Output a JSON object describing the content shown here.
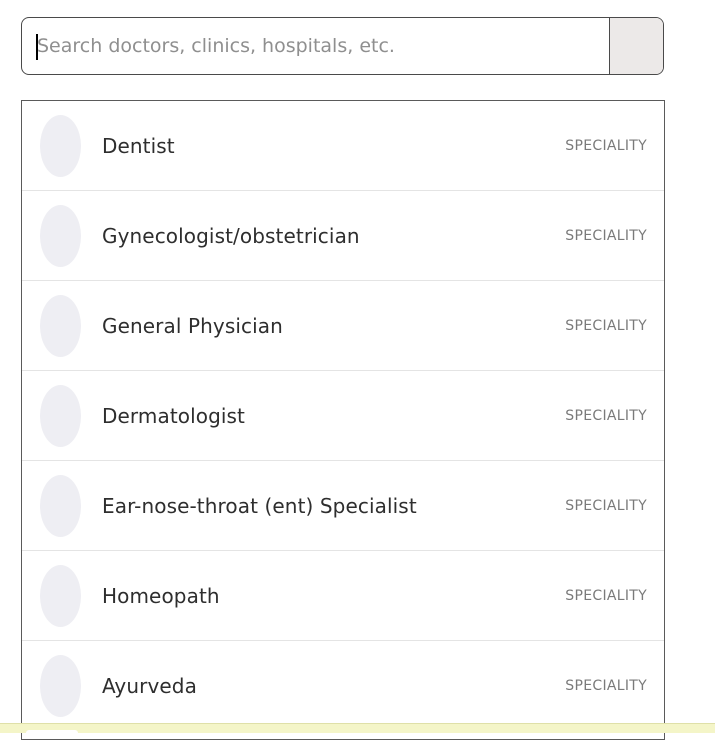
{
  "search": {
    "placeholder": "Search doctors, clinics, hospitals, etc.",
    "value": ""
  },
  "results": [
    {
      "name": "Dentist",
      "type": "SPECIALITY"
    },
    {
      "name": "Gynecologist/obstetrician",
      "type": "SPECIALITY"
    },
    {
      "name": "General Physician",
      "type": "SPECIALITY"
    },
    {
      "name": "Dermatologist",
      "type": "SPECIALITY"
    },
    {
      "name": "Ear-nose-throat (ent) Specialist",
      "type": "SPECIALITY"
    },
    {
      "name": "Homeopath",
      "type": "SPECIALITY"
    },
    {
      "name": "Ayurveda",
      "type": "SPECIALITY"
    }
  ],
  "colors": {
    "avatar_placeholder": "#eeeef3",
    "search_button_bg": "#ece9e8",
    "bottom_bar": "#f4f5c8"
  }
}
